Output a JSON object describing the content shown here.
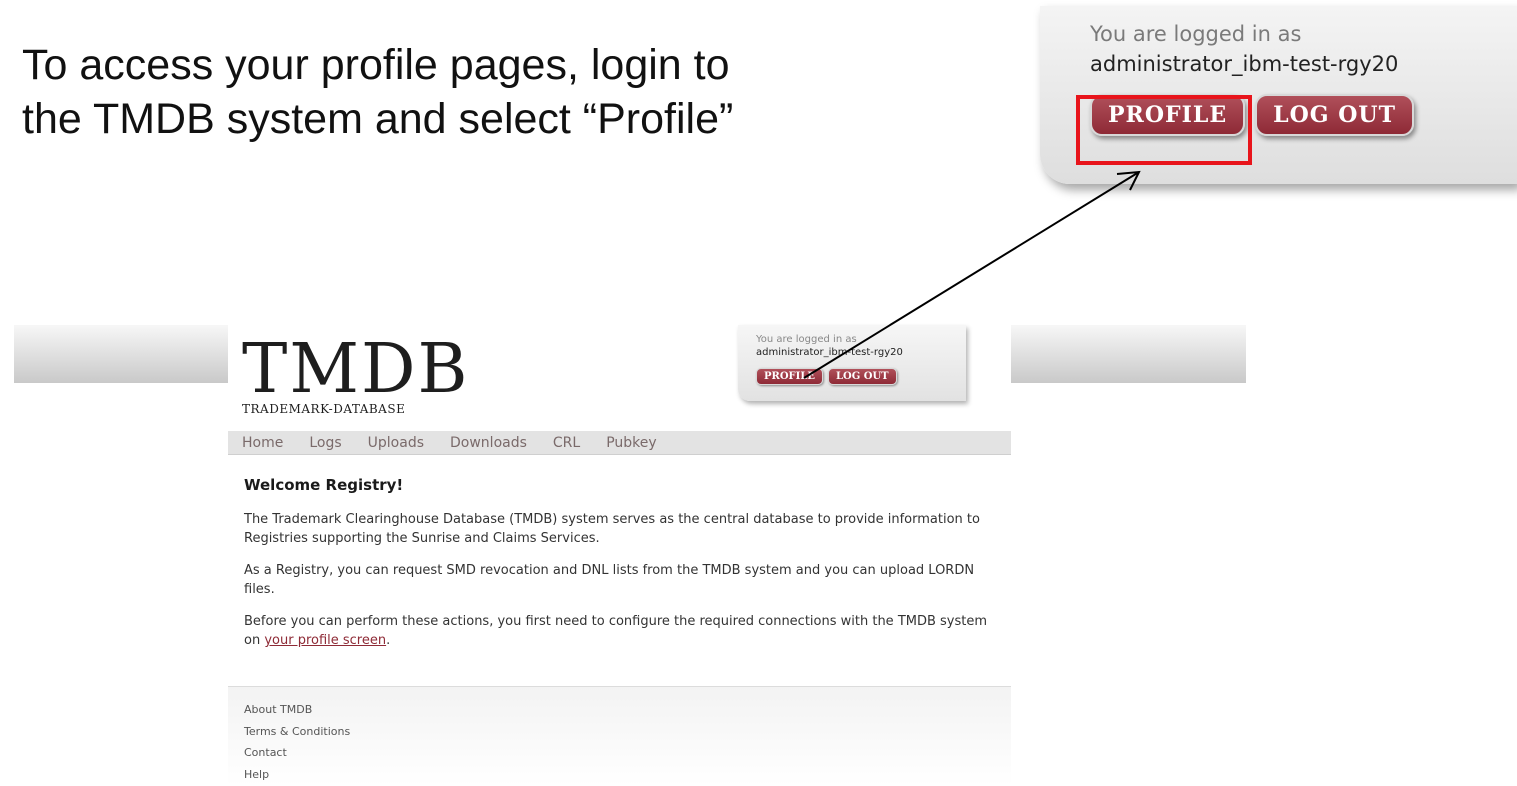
{
  "caption": {
    "line1": "To access your profile pages, login to",
    "line2": "the TMDB system and select “Profile”"
  },
  "zoom": {
    "logged_in_label": "You are logged in as",
    "username": "administrator_ibm-test-rgy20",
    "profile_button": "PROFILE",
    "logout_button": "LOG OUT",
    "highlight_color": "#e8141b"
  },
  "site": {
    "logo": "TMDB",
    "logo_sub": "TRADEMARK-DATABASE",
    "login": {
      "logged_in_label": "You are logged in as",
      "username": "administrator_ibm-test-rgy20",
      "profile_button": "PROFILE",
      "logout_button": "LOG OUT"
    },
    "nav": [
      "Home",
      "Logs",
      "Uploads",
      "Downloads",
      "CRL",
      "Pubkey"
    ],
    "heading": "Welcome Registry!",
    "para1": "The Trademark Clearinghouse Database (TMDB) system serves as the central database to provide information to Registries supporting the Sunrise and Claims Services.",
    "para2": "As a Registry, you can request SMD revocation and DNL lists from the TMDB system and you can upload LORDN files.",
    "para3_before": "Before you can perform these actions, you first need to configure the required connections with the TMDB system on ",
    "para3_link": "your profile screen",
    "para3_after": ".",
    "footer": [
      "About TMDB",
      "Terms & Conditions",
      "Contact",
      "Help"
    ],
    "button_color": "#8e2a36"
  }
}
